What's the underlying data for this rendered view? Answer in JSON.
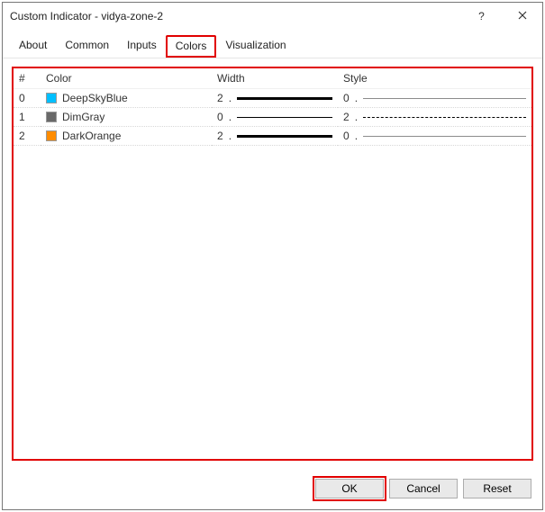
{
  "window": {
    "title": "Custom Indicator - vidya-zone-2"
  },
  "tabs": {
    "about": "About",
    "common": "Common",
    "inputs": "Inputs",
    "colors": "Colors",
    "visualization": "Visualization",
    "active": "colors"
  },
  "columns": {
    "index": "#",
    "color": "Color",
    "width": "Width",
    "style": "Style"
  },
  "rows": [
    {
      "index": "0",
      "color_name": "DeepSkyBlue",
      "swatch": "#00BFFF",
      "width": "2",
      "style": "0"
    },
    {
      "index": "1",
      "color_name": "DimGray",
      "swatch": "#696969",
      "width": "0",
      "style": "2"
    },
    {
      "index": "2",
      "color_name": "DarkOrange",
      "swatch": "#FF8C00",
      "width": "2",
      "style": "0"
    }
  ],
  "buttons": {
    "ok": "OK",
    "cancel": "Cancel",
    "reset": "Reset"
  }
}
